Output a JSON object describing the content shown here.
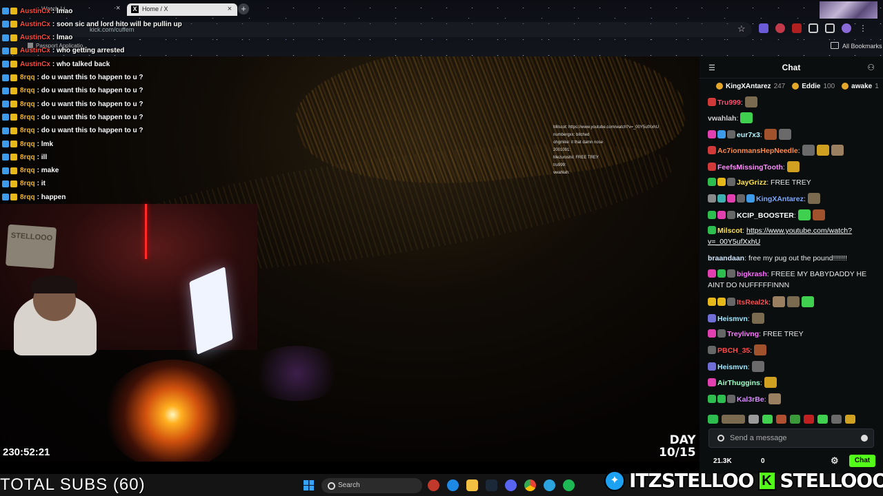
{
  "browser": {
    "active_tab": "Home / X",
    "left_tab": "Watch Li",
    "url": "kick.com/cuffem",
    "bookmark_item": "Passport Applicatio...",
    "bookmarks_label": "All Bookmarks"
  },
  "stream": {
    "uptime": "230:52:21",
    "day_line1": "DAY",
    "day_line2": "10/15",
    "overlay_chat": [
      {
        "user": "AustinCx",
        "text": ": lmao",
        "user_color": "#ff4a3d"
      },
      {
        "user": "AustinCx",
        "text": ": soon sic and lord hito will be pullin up",
        "user_color": "#ff4a3d"
      },
      {
        "user": "AustinCx",
        "text": ": lmao",
        "user_color": "#ff4a3d"
      },
      {
        "user": "AustinCx",
        "text": ": who getting arrested",
        "user_color": "#ff4a3d"
      },
      {
        "user": "AustinCx",
        "text": ": who talked back",
        "user_color": "#ff4a3d"
      },
      {
        "user": "8rqq",
        "text": ": do u want this to happen to u ?",
        "user_color": "#f5b323"
      },
      {
        "user": "8rqq",
        "text": ": do u want this to happen to u ?",
        "user_color": "#f5b323"
      },
      {
        "user": "8rqq",
        "text": ": do u want this to happen to u ?",
        "user_color": "#f5b323"
      },
      {
        "user": "8rqq",
        "text": ": do u want this to happen to u ?",
        "user_color": "#f5b323"
      },
      {
        "user": "8rqq",
        "text": ": do u want this to happen to u ?",
        "user_color": "#f5b323"
      },
      {
        "user": "8rqq",
        "text": ": lmk",
        "user_color": "#f5b323"
      },
      {
        "user": "8rqq",
        "text": ": ill",
        "user_color": "#f5b323"
      },
      {
        "user": "8rqq",
        "text": ": make",
        "user_color": "#f5b323"
      },
      {
        "user": "8rqq",
        "text": ": it",
        "user_color": "#f5b323"
      },
      {
        "user": "8rqq",
        "text": ": happen",
        "user_color": "#f5b323"
      }
    ],
    "mini_chat": [
      "Milscot: https://www.youtube.com/watch?v=_00Y5ufXxhU",
      "numbergxx: bitched",
      "ohgmike: it that damn nose",
      "2001091:",
      "Mezuroshii: FREE TREY",
      "tru999:",
      "vwahlah:"
    ],
    "total_subs": "TOTAL SUBS (60)",
    "social_handles": [
      "ITZSTELLOO",
      "STELLOOO"
    ]
  },
  "chat": {
    "title": "Chat",
    "pinned": [
      {
        "name": "KingXAntarez",
        "count": "247"
      },
      {
        "name": "Eddie",
        "count": "100"
      },
      {
        "name": "awake",
        "count": "1"
      }
    ],
    "messages": [
      {
        "user": "Tru999",
        "color": "#ff4f6e",
        "text": ":",
        "emotes": 1,
        "badges": [
          "#d23a3a"
        ]
      },
      {
        "user": "vwahlah",
        "color": "#cfcfcf",
        "text": ":",
        "emotes": 1,
        "badges": []
      },
      {
        "user": "eur7x3",
        "color": "#b7f5ff",
        "text": ":",
        "emotes": 2,
        "badges": [
          "#e23fb0",
          "#3d9be9",
          "#666"
        ]
      },
      {
        "user": "Ac7ionmansHepNeedle",
        "color": "#ff8a4a",
        "text": ":",
        "emotes": 3,
        "badges": [
          "#d23a3a"
        ]
      },
      {
        "user": "FeefsMissingTooth",
        "color": "#ff8aff",
        "text": ":",
        "emotes": 1,
        "badges": [
          "#d23a3a"
        ]
      },
      {
        "user": "JayGrizz",
        "color": "#ffe14a",
        "text": ": FREE TREY",
        "emotes": 0,
        "badges": [
          "#2ebd4f",
          "#e7b81a",
          "#666"
        ]
      },
      {
        "user": "KingXAntarez",
        "color": "#7aa8ff",
        "text": ":",
        "emotes": 1,
        "badges": [
          "#8a8a8a",
          "#3fb0b0",
          "#e23fb0",
          "#666",
          "#3d9be9"
        ]
      },
      {
        "user": "KCIP_BOOSTER",
        "color": "#ffffff",
        "text": ":",
        "emotes": 2,
        "badges": [
          "#2ebd4f",
          "#e23fb0",
          "#666"
        ]
      },
      {
        "user": "Milscot",
        "color": "#ffe14a",
        "text": ":",
        "link": "https://www.youtube.com/watch?v=_00Y5ufXxhU",
        "emotes": 0,
        "badges": [
          "#2ebd4f"
        ]
      },
      {
        "user": "braandaan",
        "color": "#cfe7ff",
        "text": ": free my pug out the pound!!!!!!!",
        "emotes": 0,
        "badges": []
      },
      {
        "user": "bigkrash",
        "color": "#ff6aff",
        "text": ": FREEE MY BABYDADDY HE AINT DO NUFFFFFINNN",
        "emotes": 0,
        "badges": [
          "#e23fb0",
          "#2ebd4f",
          "#666"
        ]
      },
      {
        "user": "ItsReal2k",
        "color": "#ff4a4a",
        "text": ":",
        "emotes": 3,
        "badges": [
          "#e7b81a",
          "#e7b81a",
          "#666"
        ]
      },
      {
        "user": "Heismvn",
        "color": "#9fe7ff",
        "text": ":",
        "emotes": 1,
        "badges": [
          "#6f6fd6"
        ]
      },
      {
        "user": "Treylivng",
        "color": "#ff7aff",
        "text": ": FREE TREY",
        "emotes": 0,
        "badges": [
          "#e23fb0",
          "#666"
        ]
      },
      {
        "user": "PBCH_35",
        "color": "#ff4a4a",
        "text": ":",
        "emotes": 1,
        "badges": [
          "#666"
        ]
      },
      {
        "user": "Heismvn",
        "color": "#9fe7ff",
        "text": ":",
        "emotes": 1,
        "badges": [
          "#6f6fd6"
        ]
      },
      {
        "user": "AirThuggins",
        "color": "#9fffc8",
        "text": ":",
        "emotes": 1,
        "badges": [
          "#e23fb0"
        ]
      },
      {
        "user": "Kal3rBe",
        "color": "#d88aff",
        "text": ":",
        "emotes": 1,
        "badges": [
          "#2ebd4f",
          "#2ebd4f",
          "#666"
        ]
      }
    ],
    "input_placeholder": "Send a message",
    "viewers": "21.3K",
    "zero": "0",
    "chat_button": "Chat"
  },
  "taskbar": {
    "search_label": "Search"
  },
  "colors": {
    "kick_green": "#53fc18",
    "chat_bg": "#0b0e0f"
  }
}
